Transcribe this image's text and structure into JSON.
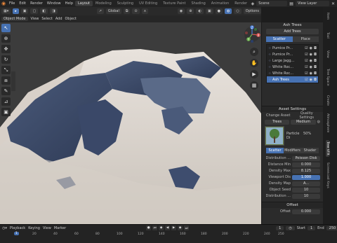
{
  "topbar": {
    "menus": [
      "File",
      "Edit",
      "Render",
      "Window",
      "Help"
    ],
    "workspaces": [
      "Layout",
      "Modeling",
      "Sculpting",
      "UV Editing",
      "Texture Paint",
      "Shading",
      "Animation",
      "Render"
    ],
    "active_workspace": "Layout",
    "scene": "Scene",
    "view_layer": "View Layer"
  },
  "viewport_header": {
    "mode": "Object Mode",
    "menus": [
      "View",
      "Select",
      "Add",
      "Object"
    ],
    "orientation": "Global",
    "options": "Options"
  },
  "gizmo": {
    "x": "X",
    "y": "Y",
    "z": "Z"
  },
  "panel": {
    "title": "Ash Trees",
    "add_button": "Add Trees",
    "tabs": [
      "Scatter",
      "Place"
    ],
    "active_tab": "Scatter",
    "list": [
      {
        "name": "Pumice Pr..."
      },
      {
        "name": "Pumice Pr..."
      },
      {
        "name": "Large Jagg..."
      },
      {
        "name": "White Roc..."
      },
      {
        "name": "White Roc..."
      },
      {
        "name": "Ash Trees"
      }
    ],
    "selected_index": 5,
    "asset_settings": {
      "title": "Asset Settings",
      "change_asset": "Change Asset",
      "quality_settings": "Quality Settings",
      "asset_value": "Trees",
      "quality_value": "Medium",
      "percentage_label": "Particle Di",
      "percentage_value": "50%"
    },
    "subtabs": [
      "Scatter",
      "Modifiers",
      "Shader"
    ],
    "active_subtab": "Scatter",
    "fields": [
      {
        "label": "Distribution ...",
        "value": "Poisson Disk"
      },
      {
        "label": "Distance Min",
        "value": "0.000"
      },
      {
        "label": "Density Max",
        "value": "8.125"
      },
      {
        "label": "Viewport Dis",
        "value": "1.000"
      },
      {
        "label": "Density Map",
        "value": "A..."
      },
      {
        "label": "Object Seed",
        "value": "10"
      },
      {
        "label": "Distribution ...",
        "value": "10"
      }
    ],
    "offset_title": "Offset",
    "offset_field": {
      "label": "Offset",
      "value": "0.000"
    }
  },
  "side_tabs": [
    "Item",
    "Tool",
    "View",
    "Tree Space",
    "Create",
    "Atmosphere",
    "Tree VFX",
    "Screencast Keys"
  ],
  "active_side_tab": "Tree VFX",
  "timeline": {
    "menus": [
      "Playback",
      "Keying",
      "View",
      "Marker"
    ],
    "current_frame": "1",
    "start_label": "Start",
    "start": "1",
    "end_label": "End",
    "end": "250",
    "ruler": [
      "1",
      "20",
      "40",
      "60",
      "80",
      "100",
      "120",
      "140",
      "160",
      "180",
      "200",
      "220",
      "240",
      "250"
    ]
  }
}
